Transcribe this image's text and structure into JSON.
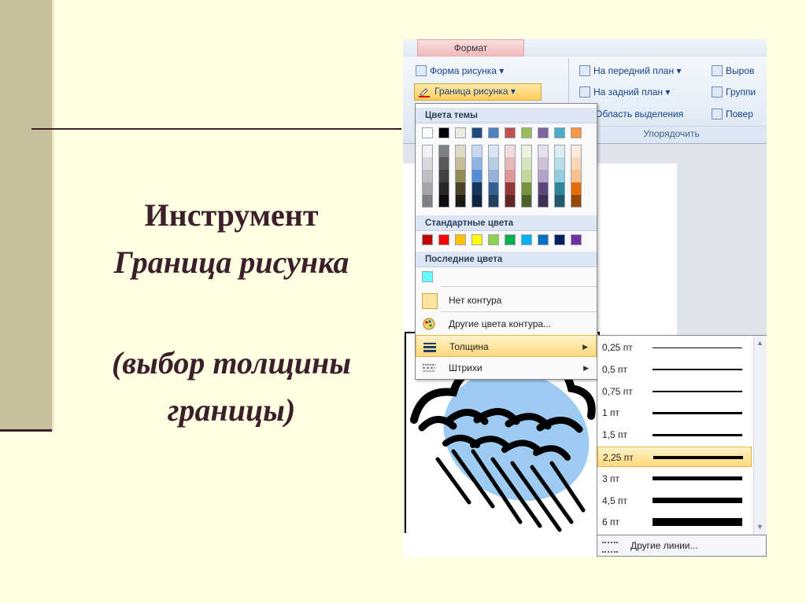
{
  "slide": {
    "line1": "Инструмент",
    "line2": "Граница рисунка",
    "line3": "(выбор толщины",
    "line4": "границы)"
  },
  "ribbon": {
    "tab": "Формат",
    "shape": "Форма рисунка",
    "border": "Граница рисунка",
    "bring_front": "На передний план",
    "send_back": "На задний план",
    "selection_pane": "Область выделения",
    "align": "Выров",
    "group": "Группи",
    "rotate": "Повер",
    "group_label": "Упорядочить"
  },
  "menu": {
    "theme_colors": "Цвета темы",
    "standard_colors": "Стандартные цвета",
    "recent_colors": "Последние цвета",
    "no_outline": "Нет контура",
    "more_colors": "Другие цвета контура...",
    "weight": "Толщина",
    "dashes": "Штрихи"
  },
  "theme_top": [
    "#ffffff",
    "#000000",
    "#eeece1",
    "#1f497d",
    "#4f81bd",
    "#c0504d",
    "#9bbb59",
    "#8064a2",
    "#4bacc6",
    "#f79646"
  ],
  "theme_shades": [
    [
      "#f2f2f2",
      "#d9d9d9",
      "#bfbfbf",
      "#a6a6a6",
      "#808080"
    ],
    [
      "#7f7f7f",
      "#595959",
      "#404040",
      "#262626",
      "#0d0d0d"
    ],
    [
      "#ddd9c3",
      "#c4bd97",
      "#938953",
      "#494429",
      "#1d1b10"
    ],
    [
      "#c6d9f0",
      "#8db3e2",
      "#548dd4",
      "#17365d",
      "#0f243e"
    ],
    [
      "#dbe5f1",
      "#b8cce4",
      "#95b3d7",
      "#366092",
      "#244061"
    ],
    [
      "#f2dcdb",
      "#e5b9b7",
      "#d99694",
      "#953734",
      "#632423"
    ],
    [
      "#ebf1dd",
      "#d7e3bc",
      "#c3d69b",
      "#76923c",
      "#4f6128"
    ],
    [
      "#e5e0ec",
      "#ccc1d9",
      "#b2a2c7",
      "#5f497a",
      "#3f3151"
    ],
    [
      "#dbeef3",
      "#b7dde8",
      "#92cddc",
      "#31859b",
      "#205867"
    ],
    [
      "#fdeada",
      "#fbd5b5",
      "#fac08f",
      "#e36c09",
      "#974806"
    ]
  ],
  "standard": [
    "#c00000",
    "#ff0000",
    "#ffc000",
    "#ffff00",
    "#92d050",
    "#00b050",
    "#00b0f0",
    "#0070c0",
    "#002060",
    "#7030a0"
  ],
  "recent": [
    "#66ffff"
  ],
  "weights": [
    {
      "label": "0,25 пт",
      "w": 1
    },
    {
      "label": "0,5 пт",
      "w": 1.5
    },
    {
      "label": "0,75 пт",
      "w": 2
    },
    {
      "label": "1 пт",
      "w": 2.5
    },
    {
      "label": "1,5 пт",
      "w": 3
    },
    {
      "label": "2,25 пт",
      "w": 4
    },
    {
      "label": "3 пт",
      "w": 5
    },
    {
      "label": "4,5 пт",
      "w": 7
    },
    {
      "label": "6 пт",
      "w": 10
    }
  ],
  "selected_weight": "2,25 пт",
  "more_lines": "Другие линии..."
}
